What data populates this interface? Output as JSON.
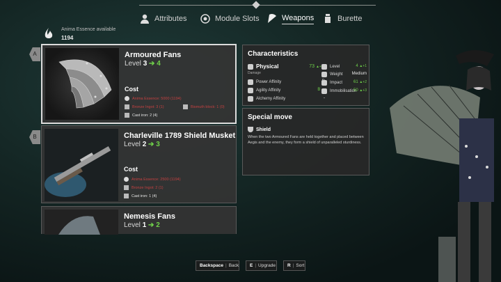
{
  "nav": {
    "attributes": "Attributes",
    "module_slots": "Module Slots",
    "weapons": "Weapons",
    "burette": "Burette"
  },
  "essence": {
    "label": "Anima Essence available",
    "value": "1194"
  },
  "tabs": {
    "a": "A",
    "b": "B"
  },
  "weapons": [
    {
      "name": "Armoured Fans",
      "level_label": "Level",
      "level_current": "3",
      "level_next": "4",
      "cost_title": "Cost",
      "costs": [
        {
          "text": "Anima Essence: 5000 (1194)",
          "color": "#c44141"
        },
        {
          "text": "Bronze Ingot: 3 (1)",
          "color": "#c44141"
        },
        {
          "text": "Bismuth block: 1 (0)",
          "color": "#c44141"
        },
        {
          "text": "Cast iron: 2 (4)",
          "color": "#e6e6e6"
        }
      ]
    },
    {
      "name": "Charleville 1789 Shield Musket",
      "level_label": "Level",
      "level_current": "2",
      "level_next": "3",
      "cost_title": "Cost",
      "costs": [
        {
          "text": "Anima Essence: 2500 (1194)",
          "color": "#c44141"
        },
        {
          "text": "Bronze Ingot: 2 (1)",
          "color": "#c44141"
        },
        {
          "text": "Cast iron: 1 (4)",
          "color": "#e6e6e6"
        }
      ]
    },
    {
      "name": "Nemesis Fans",
      "level_label": "Level",
      "level_current": "1",
      "level_next": "2"
    }
  ],
  "characteristics": {
    "title": "Characteristics",
    "damage_type": "Physical",
    "damage_value": "73",
    "damage_delta": "▲+11",
    "damage_label": "Damage",
    "power_affinity": "Power Affinity",
    "power_value": "D",
    "agility_affinity": "Agility Affinity",
    "agility_value": "B",
    "agility_delta": "▲",
    "alchemy_affinity": "Alchemy Affinity",
    "alchemy_value": "-",
    "level": "Level",
    "level_value": "4",
    "level_delta": "▲+1",
    "weight": "Weight",
    "weight_value": "Medium",
    "impact": "Impact",
    "impact_value": "61",
    "impact_delta": "▲+2",
    "immobilisation": "Immobilisation",
    "immobilisation_value": "50",
    "immobilisation_delta": "▲+3"
  },
  "special": {
    "title": "Special move",
    "move_name": "Shield",
    "description": "When the two Armoured Fans are held together and placed between Aegis and the enemy, they form a shield of unparalleled sturdiness."
  },
  "hints": [
    {
      "key": "Backspace",
      "label": "Back"
    },
    {
      "key": "E",
      "label": "Upgrade"
    },
    {
      "key": "R",
      "label": "Sort"
    }
  ],
  "colors": {
    "accent_green": "#6fd04a",
    "cost_red": "#c44141",
    "panel_bg": "#2f2f2f"
  }
}
